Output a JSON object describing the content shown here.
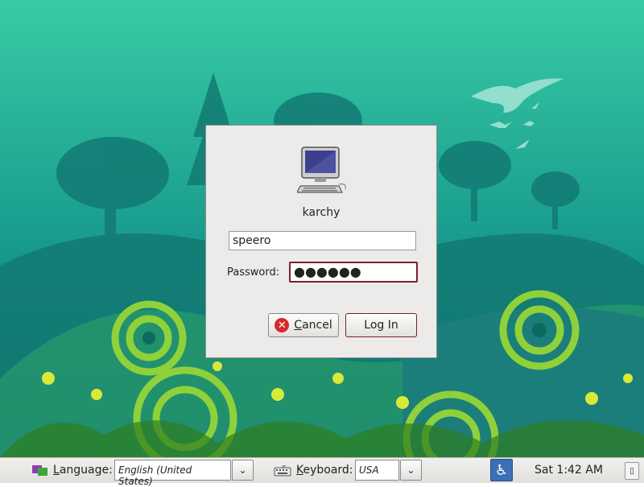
{
  "login_dialog": {
    "username": "karchy",
    "username_field_value": "speero",
    "password_label": "Password:",
    "password_masked": "●●●●●●",
    "cancel_label_prefix": "",
    "cancel_label_accel": "C",
    "cancel_label_rest": "ancel",
    "login_label": "Log In",
    "icon": "computer-icon"
  },
  "panel": {
    "language_label_accel": "L",
    "language_label_rest": "anguage:",
    "language_value": "English (United States)",
    "keyboard_label_accel": "K",
    "keyboard_label_rest": "eyboard:",
    "keyboard_value": "USA",
    "clock": "Sat  1:42 AM",
    "accessibility_icon": "accessibility-icon",
    "shutdown_icon": "shutdown-icon"
  },
  "colors": {
    "wallpaper_top": "#36c9a3",
    "wallpaper_bottom": "#0e6e6a",
    "focus_border": "#7a1f2a",
    "accessibility_blue": "#3b6fb6"
  }
}
